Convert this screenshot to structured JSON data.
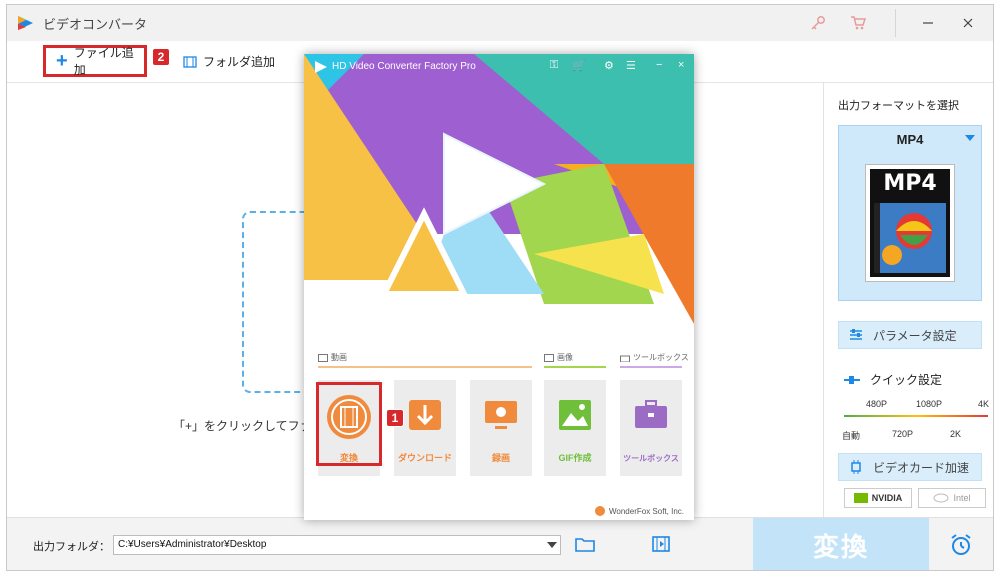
{
  "window": {
    "title": "ビデオコンバータ"
  },
  "toolbar": {
    "add_file_label": "ファイル追加",
    "add_folder_label": "フォルダ追加",
    "badge_add_file": "2"
  },
  "main": {
    "drop_hint": "「+」をクリックしてファ"
  },
  "right_panel": {
    "output_format_title": "出力フォーマットを選択",
    "format_name": "MP4",
    "format_thumb_text": "MP4",
    "params_label": "パラメータ設定",
    "quick_label": "クイック設定",
    "quick_top_ticks": [
      "480P",
      "1080P",
      "4K"
    ],
    "quick_bottom_ticks": [
      "自動",
      "720P",
      "2K"
    ],
    "gpu_label": "ビデオカード加速",
    "gpu_nvidia": "NVIDIA",
    "gpu_intel": "Intel"
  },
  "bottom": {
    "output_folder_label": "出力フォルダ：",
    "output_path": "C:¥Users¥Administrator¥Desktop",
    "convert_label": "変換"
  },
  "launcher": {
    "title": "HD Video Converter Factory Pro",
    "sections": {
      "video": "動画",
      "image": "画像",
      "toolbox": "ツールボックス"
    },
    "tiles": [
      {
        "label": "変換",
        "color": "#f08a3c"
      },
      {
        "label": "ダウンロード",
        "color": "#f08a3c"
      },
      {
        "label": "録画",
        "color": "#f08a3c"
      },
      {
        "label": "GIF作成",
        "color": "#6fbf3b"
      },
      {
        "label": "ツールボックス",
        "color": "#9c6cc4"
      }
    ],
    "badge_convert": "1",
    "footer": "WonderFox Soft, Inc."
  }
}
